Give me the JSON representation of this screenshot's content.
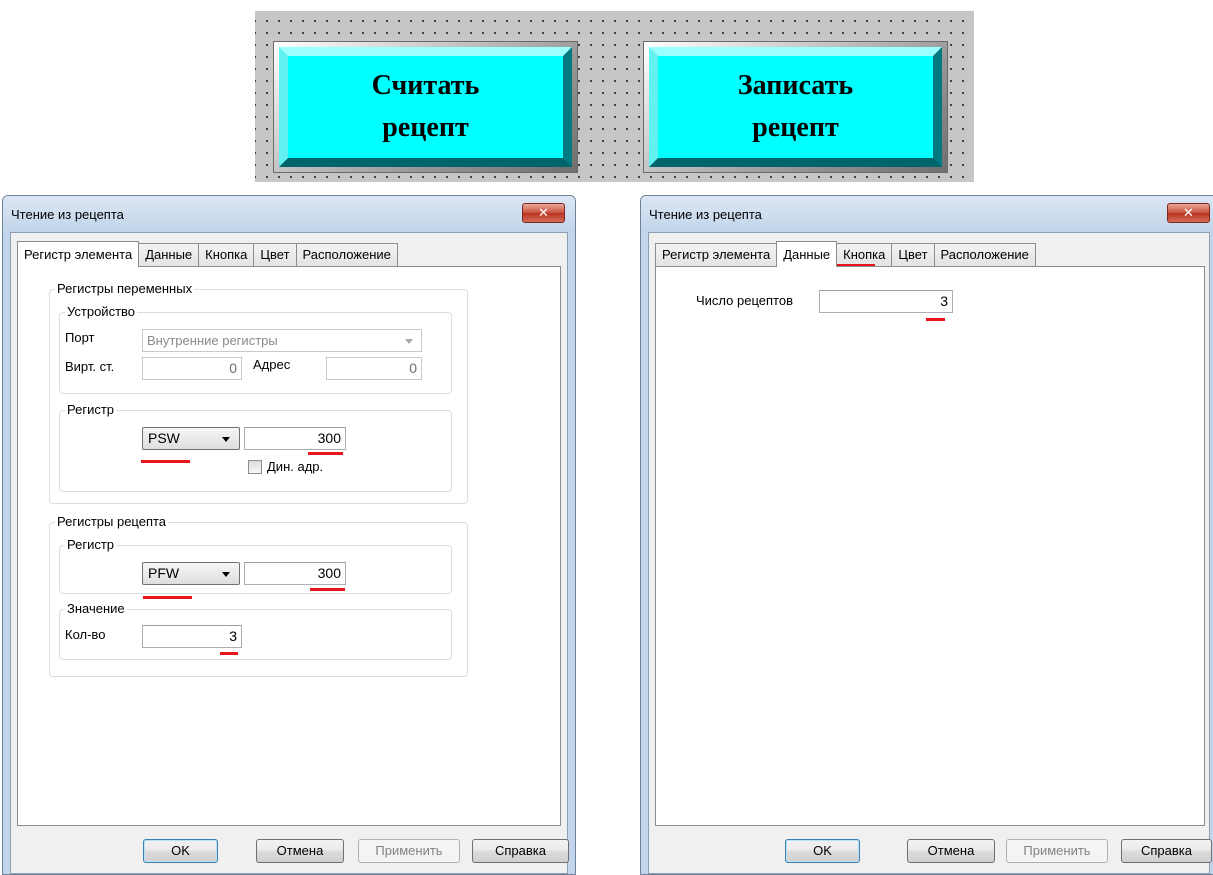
{
  "hmi": {
    "read_button": "Считать\nрецепт",
    "write_button": "Записать\nрецепт",
    "button_color": "#00ffff"
  },
  "dialog_left": {
    "title": "Чтение из рецепта",
    "close_icon": "close-icon",
    "tabs": [
      "Регистр элемента",
      "Данные",
      "Кнопка",
      "Цвет",
      "Расположение"
    ],
    "active_tab": "Регистр элемента",
    "variable_registers": {
      "legend": "Регистры переменных",
      "device": {
        "legend": "Устройство",
        "port_label": "Порт",
        "port_value": "Внутренние регистры",
        "virt_label": "Вирт. ст.",
        "virt_value": "0",
        "address_label": "Адрес",
        "address_value": "0"
      },
      "register": {
        "legend": "Регистр",
        "type": "PSW",
        "value": "300",
        "dyn_address_label": "Дин. адр.",
        "dyn_address_checked": false
      }
    },
    "recipe_registers": {
      "legend": "Регистры рецепта",
      "register": {
        "legend": "Регистр",
        "type": "PFW",
        "value": "300"
      },
      "value_group": {
        "legend": "Значение",
        "count_label": "Кол-во",
        "count_value": "3"
      }
    },
    "buttons": {
      "ok": "OK",
      "cancel": "Отмена",
      "apply": "Применить",
      "help": "Справка"
    }
  },
  "dialog_right": {
    "title": "Чтение из рецепта",
    "close_icon": "close-icon",
    "tabs": [
      "Регистр элемента",
      "Данные",
      "Кнопка",
      "Цвет",
      "Расположение"
    ],
    "active_tab": "Данные",
    "recipe_count_label": "Число рецептов",
    "recipe_count_value": "3",
    "buttons": {
      "ok": "OK",
      "cancel": "Отмена",
      "apply": "Применить",
      "help": "Справка"
    }
  },
  "highlight_color": "#e8151d"
}
